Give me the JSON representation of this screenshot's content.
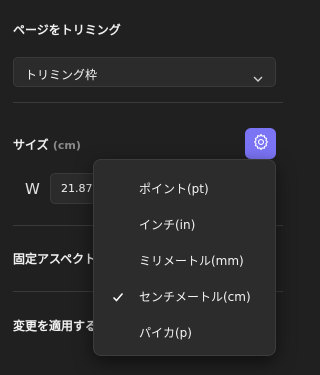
{
  "page_crop": {
    "title": "ページをトリミング",
    "select_value": "トリミング枠"
  },
  "size": {
    "title": "サイズ",
    "unit": "(cm)",
    "width_label": "W",
    "width_value": "21.87"
  },
  "aspect": {
    "label": "固定アスペクト"
  },
  "apply": {
    "label": "変更を適用する"
  },
  "unit_menu": {
    "items": [
      {
        "label": "ポイント(pt)",
        "checked": false
      },
      {
        "label": "インチ(in)",
        "checked": false
      },
      {
        "label": "ミリメートル(mm)",
        "checked": false
      },
      {
        "label": "センチメートル(cm)",
        "checked": true
      },
      {
        "label": "パイカ(p)",
        "checked": false
      }
    ]
  },
  "colors": {
    "background": "#202020",
    "accent": "#7b74f5",
    "menu_bg": "#2c2c2c"
  },
  "icons": [
    "chevron-down-icon",
    "gear-icon",
    "checkmark-icon"
  ]
}
